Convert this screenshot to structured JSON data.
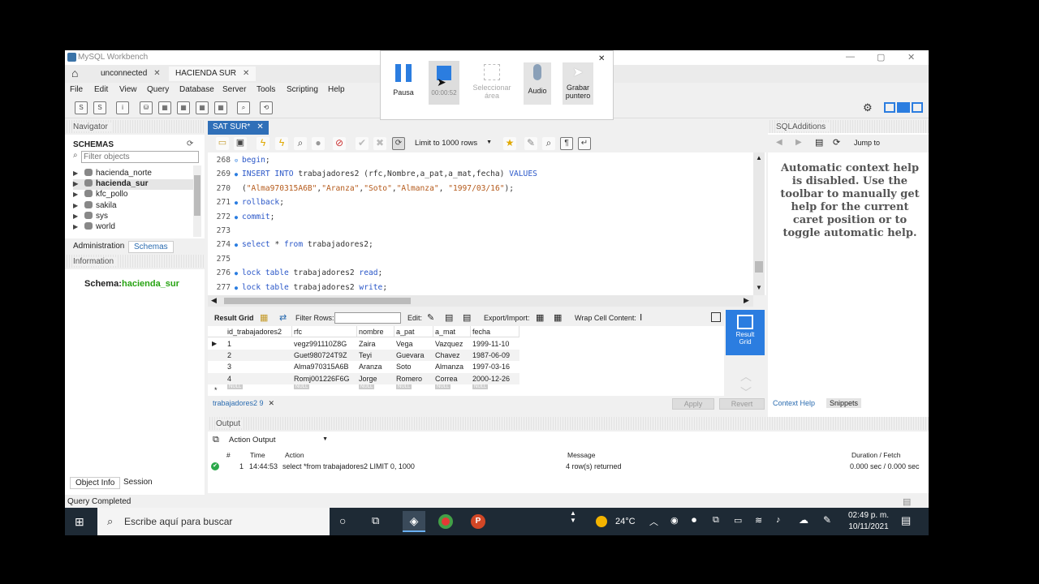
{
  "window": {
    "title": "MySQL Workbench"
  },
  "connection_tabs": [
    {
      "label": "unconnected"
    },
    {
      "label": "HACIENDA SUR"
    }
  ],
  "menu": [
    "File",
    "Edit",
    "View",
    "Query",
    "Database",
    "Server",
    "Tools",
    "Scripting",
    "Help"
  ],
  "navigator": {
    "title": "Navigator",
    "schemas_label": "SCHEMAS",
    "filter_placeholder": "Filter objects",
    "schemas": [
      "hacienda_norte",
      "hacienda_sur",
      "kfc_pollo",
      "sakila",
      "sys",
      "world"
    ],
    "selected_schema": "hacienda_sur",
    "tabs": [
      "Administration",
      "Schemas"
    ],
    "info_title": "Information",
    "schema_label": "Schema:",
    "schema_value": "hacienda_sur",
    "bottom_tabs": [
      "Object Info",
      "Session"
    ]
  },
  "editor": {
    "tab_label": "SAT SUR*",
    "limit_label": "Limit to 1000 rows",
    "lines": [
      {
        "n": "268",
        "dot": "circle",
        "parts": [
          [
            "kw",
            "begin"
          ],
          [
            "code",
            ";"
          ]
        ]
      },
      {
        "n": "269",
        "dot": "bullet",
        "parts": [
          [
            "kw",
            "INSERT INTO "
          ],
          [
            "code",
            "trabajadores2 (rfc,Nombre,a_pat,a_mat,fecha) "
          ],
          [
            "kw",
            "VALUES"
          ]
        ]
      },
      {
        "n": "270",
        "dot": "",
        "parts": [
          [
            "code",
            "("
          ],
          [
            "str",
            "\"Alma970315A6B\""
          ],
          [
            "code",
            ","
          ],
          [
            "str",
            "\"Aranza\""
          ],
          [
            "code",
            ","
          ],
          [
            "str",
            "\"Soto\""
          ],
          [
            "code",
            ","
          ],
          [
            "str",
            "\"Almanza\""
          ],
          [
            "code",
            ", "
          ],
          [
            "str",
            "\"1997/03/16\""
          ],
          [
            "code",
            ");"
          ]
        ]
      },
      {
        "n": "271",
        "dot": "bullet",
        "parts": [
          [
            "kw",
            "rollback"
          ],
          [
            "code",
            ";"
          ]
        ]
      },
      {
        "n": "272",
        "dot": "bullet",
        "parts": [
          [
            "kw",
            "commit"
          ],
          [
            "code",
            ";"
          ]
        ]
      },
      {
        "n": "273",
        "dot": "",
        "parts": []
      },
      {
        "n": "274",
        "dot": "bullet",
        "parts": [
          [
            "kw",
            "select "
          ],
          [
            "code",
            "* "
          ],
          [
            "kw",
            "from "
          ],
          [
            "code",
            "trabajadores2;"
          ]
        ]
      },
      {
        "n": "275",
        "dot": "",
        "parts": []
      },
      {
        "n": "276",
        "dot": "bullet",
        "parts": [
          [
            "kw",
            "lock table "
          ],
          [
            "code",
            "trabajadores2 "
          ],
          [
            "kw",
            "read"
          ],
          [
            "code",
            ";"
          ]
        ]
      },
      {
        "n": "277",
        "dot": "bullet",
        "parts": [
          [
            "kw",
            "lock table "
          ],
          [
            "code",
            "trabajadores2 "
          ],
          [
            "kw",
            "write"
          ],
          [
            "code",
            ";"
          ]
        ]
      }
    ]
  },
  "result": {
    "result_grid_label": "Result Grid",
    "filter_label": "Filter Rows:",
    "edit_label": "Edit:",
    "export_label": "Export/Import:",
    "wrap_label": "Wrap Cell Content:",
    "side_label_1": "Result",
    "side_label_2": "Grid",
    "columns": [
      "id_trabajadores2",
      "rfc",
      "nombre",
      "a_pat",
      "a_mat",
      "fecha"
    ],
    "rows": [
      [
        "1",
        "vegz991110Z8G",
        "Zaira",
        "Vega",
        "Vazquez",
        "1999-11-10"
      ],
      [
        "2",
        "Guet980724T9Z",
        "Teyi",
        "Guevara",
        "Chavez",
        "1987-06-09"
      ],
      [
        "3",
        "Alma970315A6B",
        "Aranza",
        "Soto",
        "Almanza",
        "1997-03-16"
      ],
      [
        "4",
        "Romj001226F6G",
        "Jorge",
        "Romero",
        "Correa",
        "2000-12-26"
      ]
    ],
    "null_label": "NULL",
    "bottom_tab": "trabajadores2 9",
    "apply_label": "Apply",
    "revert_label": "Revert"
  },
  "sql_additions": {
    "title": "SQLAdditions",
    "jump_label": "Jump to",
    "context_text": "Automatic context help is disabled. Use the toolbar to manually get help for the current caret position or to toggle automatic help.",
    "tabs": [
      "Context Help",
      "Snippets"
    ]
  },
  "output": {
    "title": "Output",
    "mode": "Action Output",
    "headers": [
      "#",
      "Time",
      "Action",
      "Message",
      "Duration / Fetch"
    ],
    "row": {
      "num": "1",
      "time": "14:44:53",
      "action": "select *from trabajadores2 LIMIT 0, 1000",
      "message": "4 row(s) returned",
      "duration": "0.000 sec / 0.000 sec"
    }
  },
  "status": "Query Completed",
  "recorder": {
    "pause": "Pausa",
    "timer": "00:00:52",
    "select_area_1": "Seleccionar",
    "select_area_2": "área",
    "audio": "Audio",
    "pointer_1": "Grabar",
    "pointer_2": "puntero"
  },
  "taskbar": {
    "search_placeholder": "Escribe aquí para buscar",
    "weather": "24°C",
    "time": "02:49 p. m.",
    "date": "10/11/2021"
  },
  "colors": {
    "accent": "#2f6fb8",
    "keyword": "#2a57c8",
    "string": "#b55a1b",
    "schema_value": "#27a312"
  }
}
